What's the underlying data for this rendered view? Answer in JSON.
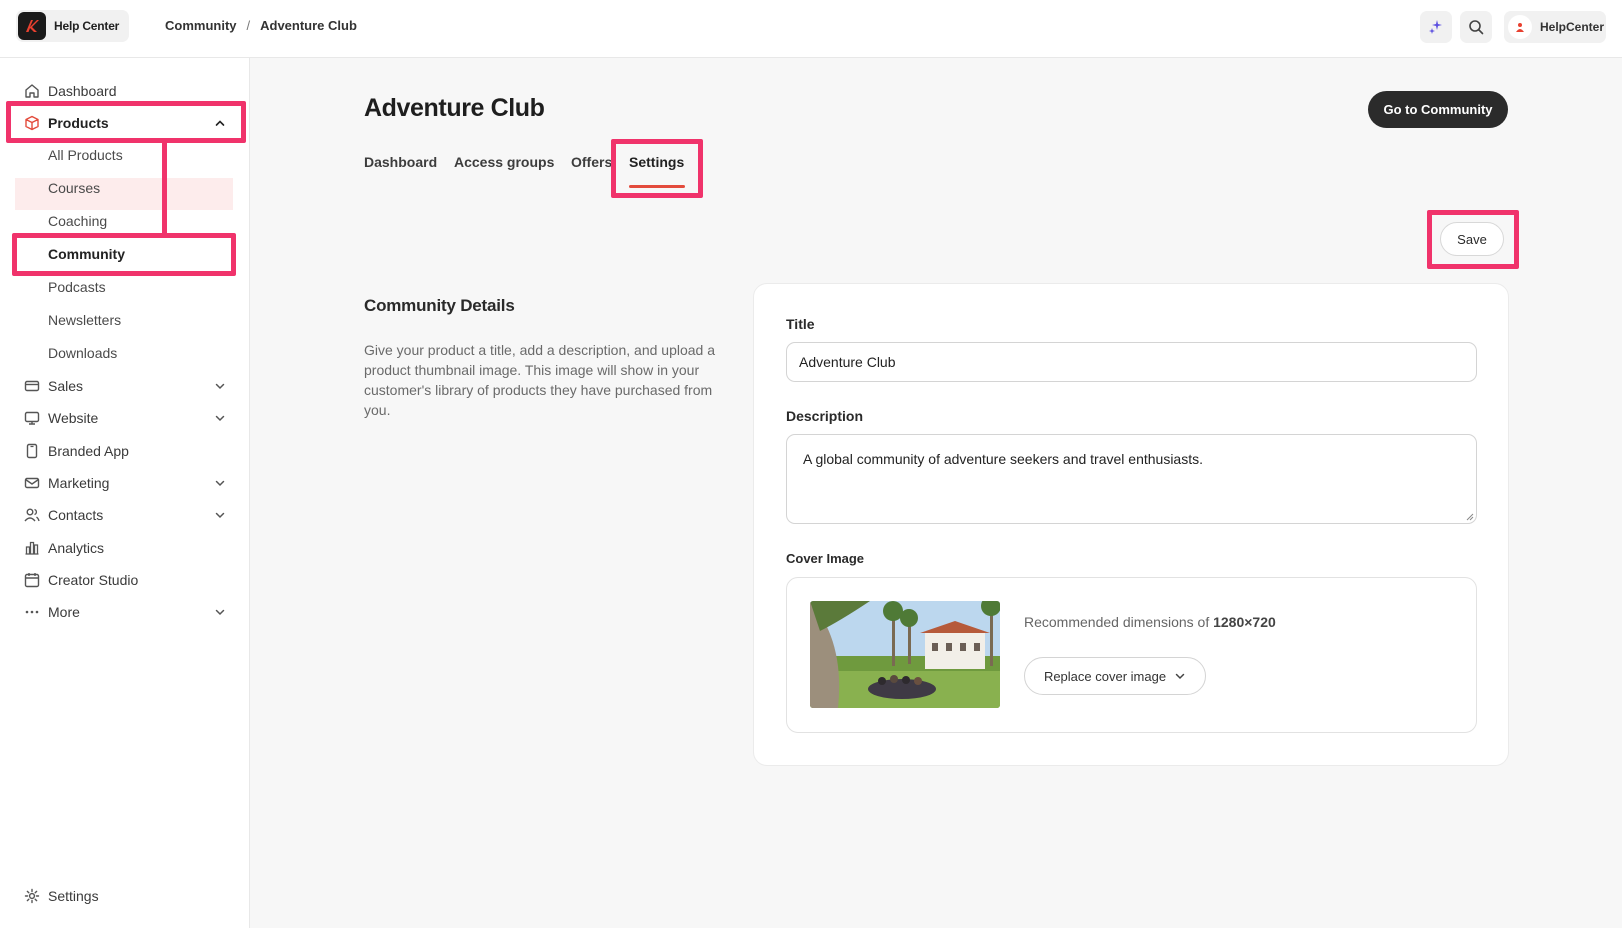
{
  "brand": {
    "name": "Help Center",
    "logo_icon": "brand-logo"
  },
  "breadcrumb": {
    "items": [
      "Community",
      "Adventure Club"
    ],
    "separator": "/"
  },
  "topbar": {
    "user_name": "HelpCenter",
    "ai_icon": "sparkle-icon",
    "search_icon": "search-icon"
  },
  "sidebar": {
    "items": [
      {
        "label": "Dashboard",
        "icon": "home-icon"
      },
      {
        "label": "Products",
        "icon": "box-icon",
        "expanded": true
      },
      {
        "label": "All Products"
      },
      {
        "label": "Courses"
      },
      {
        "label": "Coaching"
      },
      {
        "label": "Community",
        "active": true
      },
      {
        "label": "Podcasts"
      },
      {
        "label": "Newsletters"
      },
      {
        "label": "Downloads"
      },
      {
        "label": "Sales",
        "icon": "card-icon"
      },
      {
        "label": "Website",
        "icon": "monitor-icon"
      },
      {
        "label": "Branded App",
        "icon": "phone-icon"
      },
      {
        "label": "Marketing",
        "icon": "mail-icon"
      },
      {
        "label": "Contacts",
        "icon": "users-icon"
      },
      {
        "label": "Analytics",
        "icon": "chart-icon"
      },
      {
        "label": "Creator Studio",
        "icon": "calendar-icon"
      },
      {
        "label": "More",
        "icon": "dots-icon"
      }
    ],
    "settings_label": "Settings"
  },
  "page": {
    "title": "Adventure Club",
    "go_button": "Go to Community",
    "tabs": [
      "Dashboard",
      "Access groups",
      "Offers",
      "Settings"
    ],
    "active_tab": "Settings",
    "save_label": "Save"
  },
  "details": {
    "heading": "Community Details",
    "description": "Give your product a title, add a description, and upload a product thumbnail image. This image will show in your customer's library of products they have purchased from you.",
    "title_label": "Title",
    "title_value": "Adventure Club",
    "description_label": "Description",
    "description_value": "A global community of adventure seekers and travel enthusiasts.",
    "cover_label": "Cover Image",
    "dimensions_prefix": "Recommended dimensions of ",
    "dimensions_value": "1280×720",
    "replace_label": "Replace cover image"
  },
  "colors": {
    "accent": "#e34b3c",
    "highlight": "#f0336b",
    "dark_button": "#2b2b2b"
  }
}
